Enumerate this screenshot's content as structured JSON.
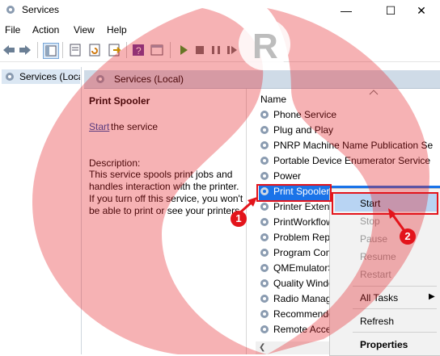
{
  "window": {
    "title": "Services",
    "controls": [
      "minimize",
      "maximize",
      "close"
    ]
  },
  "menu": [
    "File",
    "Action",
    "View",
    "Help"
  ],
  "toolbar": {
    "icons": [
      "back-icon",
      "forward-icon",
      "show-hide-tree-icon",
      "properties-icon",
      "refresh-icon",
      "export-icon",
      "help-icon",
      "console-icon",
      "start-service-icon",
      "stop-service-icon",
      "pause-service-icon",
      "restart-service-icon"
    ]
  },
  "tree": {
    "item_label": "Services (Local)"
  },
  "pane": {
    "header_title": "Services (Local)"
  },
  "details": {
    "service_name": "Print Spooler",
    "start_link": "Start",
    "start_rest": " the service",
    "description_label": "Description:",
    "description_lines": [
      "This service spools print jobs and",
      "handles interaction with the printer.",
      "If you turn off this service, you won't",
      "be able to print or see your printers."
    ]
  },
  "list": {
    "column_name": "Name",
    "rows": [
      "Phone Service",
      "Plug and Play",
      "PNRP Machine Name Publication Se",
      "Portable Device Enumerator Service",
      "Power",
      "Print Spooler",
      "Printer Extens",
      "PrintWorkflow",
      "Problem Repo",
      "Program Com",
      "QMEmulatorS",
      "Quality Windo",
      "Radio Manag",
      "Recommende",
      "Remote Acce"
    ],
    "selected_index": 5
  },
  "context_menu": {
    "items": [
      {
        "label": "Start",
        "enabled": true,
        "highlighted": true
      },
      {
        "label": "Stop",
        "enabled": false
      },
      {
        "label": "Pause",
        "enabled": false
      },
      {
        "label": "Resume",
        "enabled": false
      },
      {
        "label": "Restart",
        "enabled": false
      },
      {
        "label": "All Tasks",
        "enabled": true,
        "submenu": true
      },
      {
        "label": "Refresh",
        "enabled": true
      },
      {
        "label": "Properties",
        "enabled": true,
        "bold": true
      }
    ]
  },
  "annotations": {
    "step1": "1",
    "step2": "2",
    "color": "#e3141b"
  },
  "watermark": {
    "letter": "R"
  }
}
